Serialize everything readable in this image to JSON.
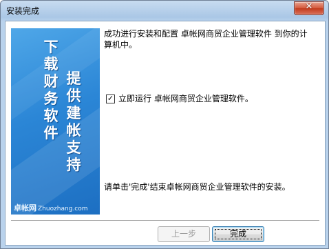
{
  "window": {
    "title": "安装完成",
    "close_glyph": "✕"
  },
  "banner": {
    "column1": [
      "下",
      "载",
      "财",
      "务",
      "软",
      "件"
    ],
    "column2": [
      "提",
      "供",
      "建",
      "帐",
      "支",
      "持"
    ],
    "logo_cn": "卓帐网",
    "logo_en": "Zhuozhang.com"
  },
  "content": {
    "message": "成功进行安装和配置 卓帐网商贸企业管理软件 到你的计算机中。",
    "run_checkbox": {
      "checked": true,
      "check_glyph": "✓",
      "label": "立即运行 卓帐网商贸企业管理软件。"
    },
    "finish_hint": "请单击'完成'结束卓帐网商贸企业管理软件的安装。"
  },
  "buttons": {
    "back": "上一步",
    "finish": "完成"
  }
}
